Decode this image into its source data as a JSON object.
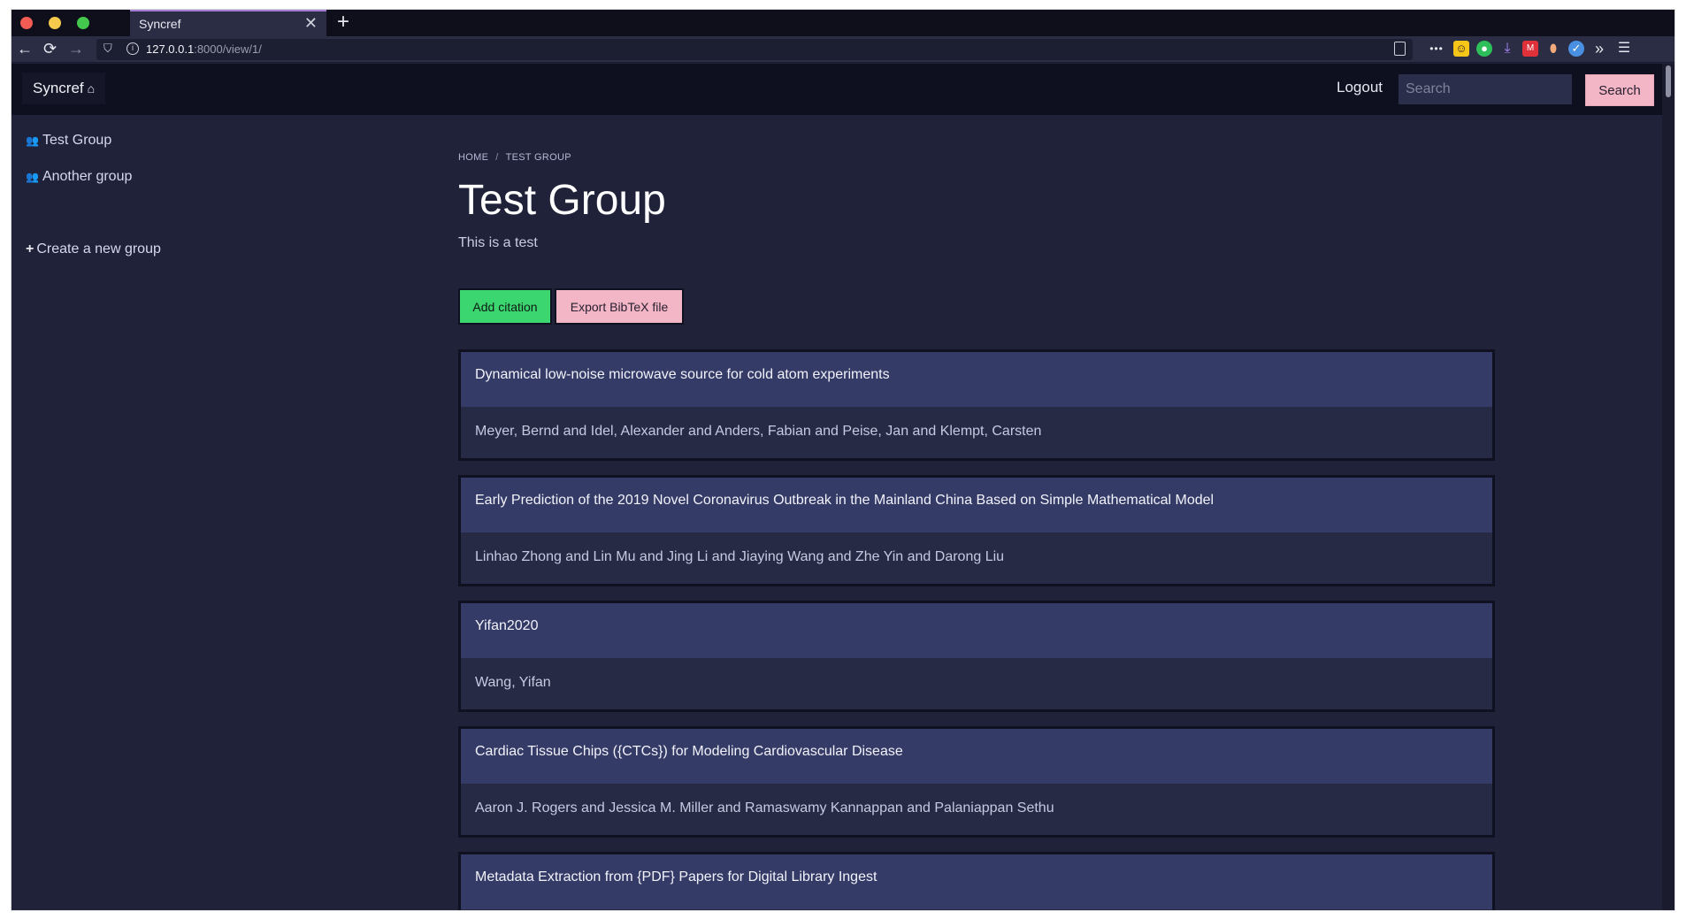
{
  "browser": {
    "tab_title": "Syncref",
    "tab_close": "✕",
    "new_tab": "+",
    "url_host": "127.0.0.1",
    "url_path": ":8000/view/1/",
    "nav": {
      "back": "←",
      "reload": "⟳",
      "forward": "→"
    },
    "overflow_menu": "•••",
    "extensions_more": "»",
    "hamburger": "☰"
  },
  "header": {
    "brand": "Syncref",
    "logout": "Logout",
    "search_placeholder": "Search",
    "search_button": "Search"
  },
  "sidebar": {
    "groups": [
      {
        "label": "Test Group"
      },
      {
        "label": "Another group"
      }
    ],
    "create_label": "Create a new group"
  },
  "breadcrumb": {
    "home": "HOME",
    "separator": "/",
    "current": "TEST GROUP"
  },
  "group": {
    "title": "Test Group",
    "description": "This is a test"
  },
  "actions": {
    "add_citation": "Add citation",
    "export_bibtex": "Export BibTeX file"
  },
  "citations": [
    {
      "title": "Dynamical low-noise microwave source for cold atom experiments",
      "authors": "Meyer, Bernd and Idel, Alexander and Anders, Fabian and Peise, Jan and Klempt, Carsten"
    },
    {
      "title": "Early Prediction of the 2019 Novel Coronavirus Outbreak in the Mainland China Based on Simple Mathematical Model",
      "authors": "Linhao Zhong and Lin Mu and Jing Li and Jiaying Wang and Zhe Yin and Darong Liu"
    },
    {
      "title": "Yifan2020",
      "authors": "Wang, Yifan"
    },
    {
      "title": "Cardiac Tissue Chips ({CTCs}) for Modeling Cardiovascular Disease",
      "authors": "Aaron J. Rogers and Jessica M. Miller and Ramaswamy Kannappan and Palaniappan Sethu"
    },
    {
      "title": "Metadata Extraction from {PDF} Papers for Digital Library Ingest",
      "authors": ""
    }
  ],
  "colors": {
    "page_bg": "#1f2238",
    "header_bg": "#0e1020",
    "card_title_bg": "#353b67",
    "add_button": "#3bd670",
    "export_button": "#f2b6c6"
  },
  "icons": {
    "group": "group-icon",
    "home": "home-icon",
    "plus": "plus-icon"
  }
}
